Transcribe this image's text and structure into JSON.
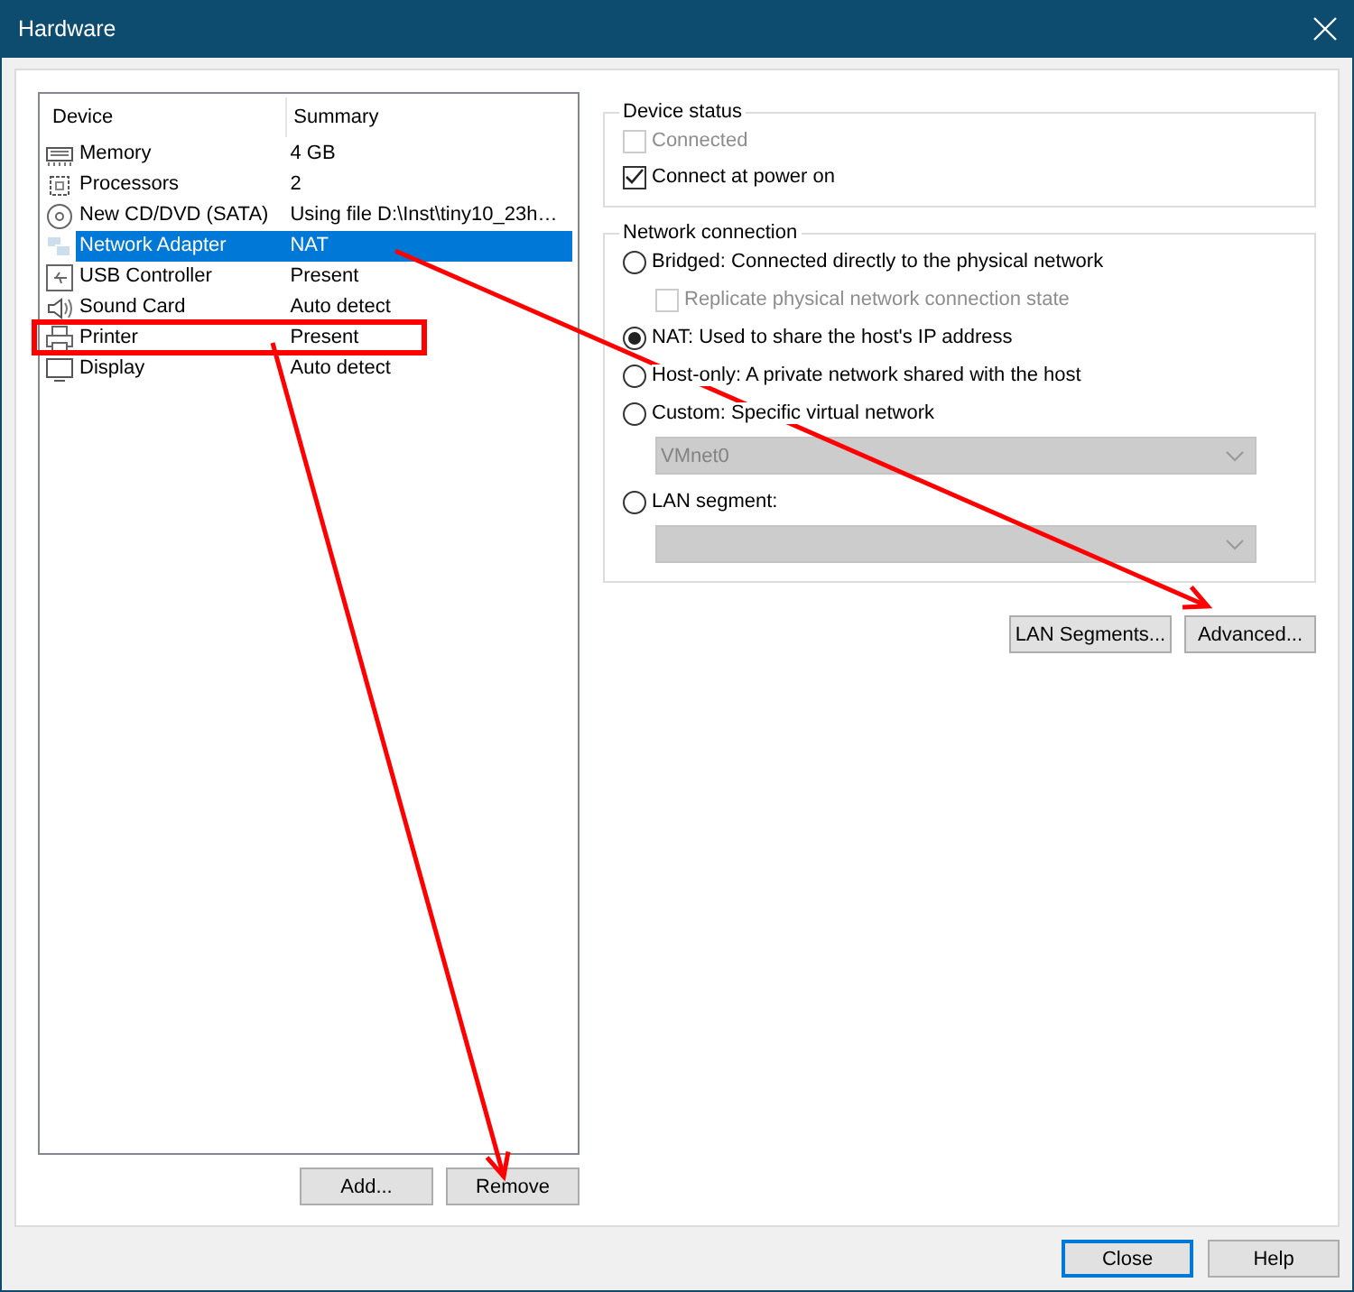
{
  "window": {
    "title": "Hardware"
  },
  "device_list": {
    "columns": [
      "Device",
      "Summary"
    ],
    "rows": [
      {
        "kind": "memory",
        "device": "Memory",
        "summary": "4 GB",
        "selected": false
      },
      {
        "kind": "cpu",
        "device": "Processors",
        "summary": "2",
        "selected": false
      },
      {
        "kind": "disc",
        "device": "New CD/DVD (SATA)",
        "summary": "Using file D:\\Inst\\tiny10_23h…",
        "selected": false
      },
      {
        "kind": "network",
        "device": "Network Adapter",
        "summary": "NAT",
        "selected": true
      },
      {
        "kind": "usb",
        "device": "USB Controller",
        "summary": "Present",
        "selected": false
      },
      {
        "kind": "sound",
        "device": "Sound Card",
        "summary": "Auto detect",
        "selected": false
      },
      {
        "kind": "printer",
        "device": "Printer",
        "summary": "Present",
        "selected": false
      },
      {
        "kind": "display",
        "device": "Display",
        "summary": "Auto detect",
        "selected": false
      }
    ]
  },
  "list_buttons": [
    "Add...",
    "Remove"
  ],
  "device_status": {
    "title": "Device status",
    "options": [
      {
        "label": "Connected",
        "checked": false,
        "disabled": true
      },
      {
        "label": "Connect at power on",
        "checked": true,
        "disabled": false
      }
    ]
  },
  "network_connection": {
    "title": "Network connection",
    "items": [
      {
        "kind": "radio",
        "label": "Bridged: Connected directly to the physical network",
        "selected": false
      },
      {
        "kind": "checkbox",
        "label": "Replicate physical network connection state",
        "checked": false,
        "disabled": true
      },
      {
        "kind": "radio",
        "label": "NAT: Used to share the host's IP address",
        "selected": true
      },
      {
        "kind": "radio",
        "label": "Host-only: A private network shared with the host",
        "selected": false
      },
      {
        "kind": "radio",
        "label": "Custom: Specific virtual network",
        "selected": false
      },
      {
        "kind": "dropdown",
        "value": "VMnet0",
        "disabled": true
      },
      {
        "kind": "radio",
        "label": "LAN segment:",
        "selected": false
      },
      {
        "kind": "dropdown",
        "disabled": true
      }
    ]
  },
  "network_buttons": [
    "LAN Segments...",
    "Advanced..."
  ],
  "footer_buttons": [
    {
      "label": "Close",
      "default": true
    },
    {
      "label": "Help",
      "default": false
    }
  ]
}
